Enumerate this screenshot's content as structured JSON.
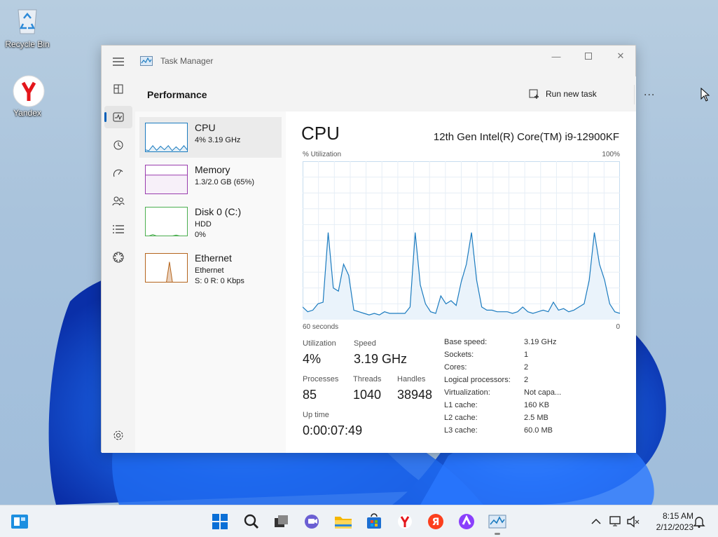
{
  "desktop": {
    "icons": [
      {
        "label": "Recycle Bin",
        "icon": "recycle-bin-icon"
      },
      {
        "label": "Yandex",
        "icon": "yandex-browser-icon"
      }
    ]
  },
  "window": {
    "title": "Task Manager",
    "page_title": "Performance",
    "run_new_task_label": "Run new task",
    "more_label": "...",
    "nav": [
      "hamburger-icon",
      "processes-icon",
      "performance-icon",
      "app-history-icon",
      "startup-apps-icon",
      "users-icon",
      "details-icon",
      "services-icon",
      "settings-icon"
    ]
  },
  "perf_list": [
    {
      "name": "CPU",
      "lines": [
        "4% 3.19 GHz"
      ],
      "color": "#1b7bbf"
    },
    {
      "name": "Memory",
      "lines": [
        "1.3/2.0 GB (65%)"
      ],
      "color": "#9a3dae"
    },
    {
      "name": "Disk 0 (C:)",
      "lines": [
        "HDD",
        "0%"
      ],
      "color": "#4caf50"
    },
    {
      "name": "Ethernet",
      "lines": [
        "Ethernet",
        "S: 0 R: 0 Kbps"
      ],
      "color": "#b5651d"
    }
  ],
  "cpu": {
    "title": "CPU",
    "model": "12th Gen Intel(R) Core(TM) i9-12900KF",
    "y_label": "% Utilization",
    "y_max_label": "100%",
    "x_left_label": "60 seconds",
    "x_right_label": "0",
    "stats": {
      "utilization_label": "Utilization",
      "utilization": "4%",
      "speed_label": "Speed",
      "speed": "3.19 GHz",
      "processes_label": "Processes",
      "processes": "85",
      "threads_label": "Threads",
      "threads": "1040",
      "handles_label": "Handles",
      "handles": "38948",
      "uptime_label": "Up time",
      "uptime": "0:00:07:49"
    },
    "specs": [
      {
        "k": "Base speed:",
        "v": "3.19 GHz"
      },
      {
        "k": "Sockets:",
        "v": "1"
      },
      {
        "k": "Cores:",
        "v": "2"
      },
      {
        "k": "Logical processors:",
        "v": "2"
      },
      {
        "k": "Virtualization:",
        "v": "Not capa..."
      },
      {
        "k": "L1 cache:",
        "v": "160 KB"
      },
      {
        "k": "L2 cache:",
        "v": "2.5 MB"
      },
      {
        "k": "L3 cache:",
        "v": "60.0 MB"
      }
    ],
    "history": [
      8,
      5,
      6,
      10,
      11,
      55,
      20,
      18,
      35,
      28,
      6,
      5,
      4,
      3,
      4,
      3,
      5,
      4,
      4,
      4,
      4,
      8,
      55,
      22,
      10,
      5,
      4,
      15,
      10,
      12,
      9,
      24,
      35,
      55,
      25,
      8,
      6,
      6,
      5,
      5,
      5,
      4,
      5,
      8,
      5,
      4,
      5,
      6,
      5,
      11,
      6,
      7,
      5,
      6,
      8,
      10,
      25,
      55,
      35,
      25,
      10,
      5,
      4
    ]
  },
  "thumbs": {
    "cpu": [
      8,
      5,
      22,
      6,
      20,
      8,
      22,
      5,
      18,
      6,
      22,
      6
    ],
    "memory": [
      65,
      65,
      65,
      65,
      65,
      65,
      65,
      65,
      65,
      65
    ],
    "disk": [
      1,
      1,
      6,
      1,
      1,
      1,
      1,
      1,
      4,
      1,
      1,
      1
    ],
    "ethernet": [
      0,
      0,
      0,
      0,
      0,
      0,
      0,
      0,
      70,
      0,
      0,
      0,
      0,
      0,
      0
    ]
  },
  "taskbar": {
    "apps": [
      "widgets-icon",
      "start-icon",
      "search-icon",
      "task-view-icon",
      "teams-chat-icon",
      "file-explorer-icon",
      "store-icon",
      "yandex-browser-icon",
      "yandex-icon",
      "alice-icon",
      "task-manager-icon"
    ],
    "time": "8:15 AM",
    "date": "2/12/2023"
  }
}
